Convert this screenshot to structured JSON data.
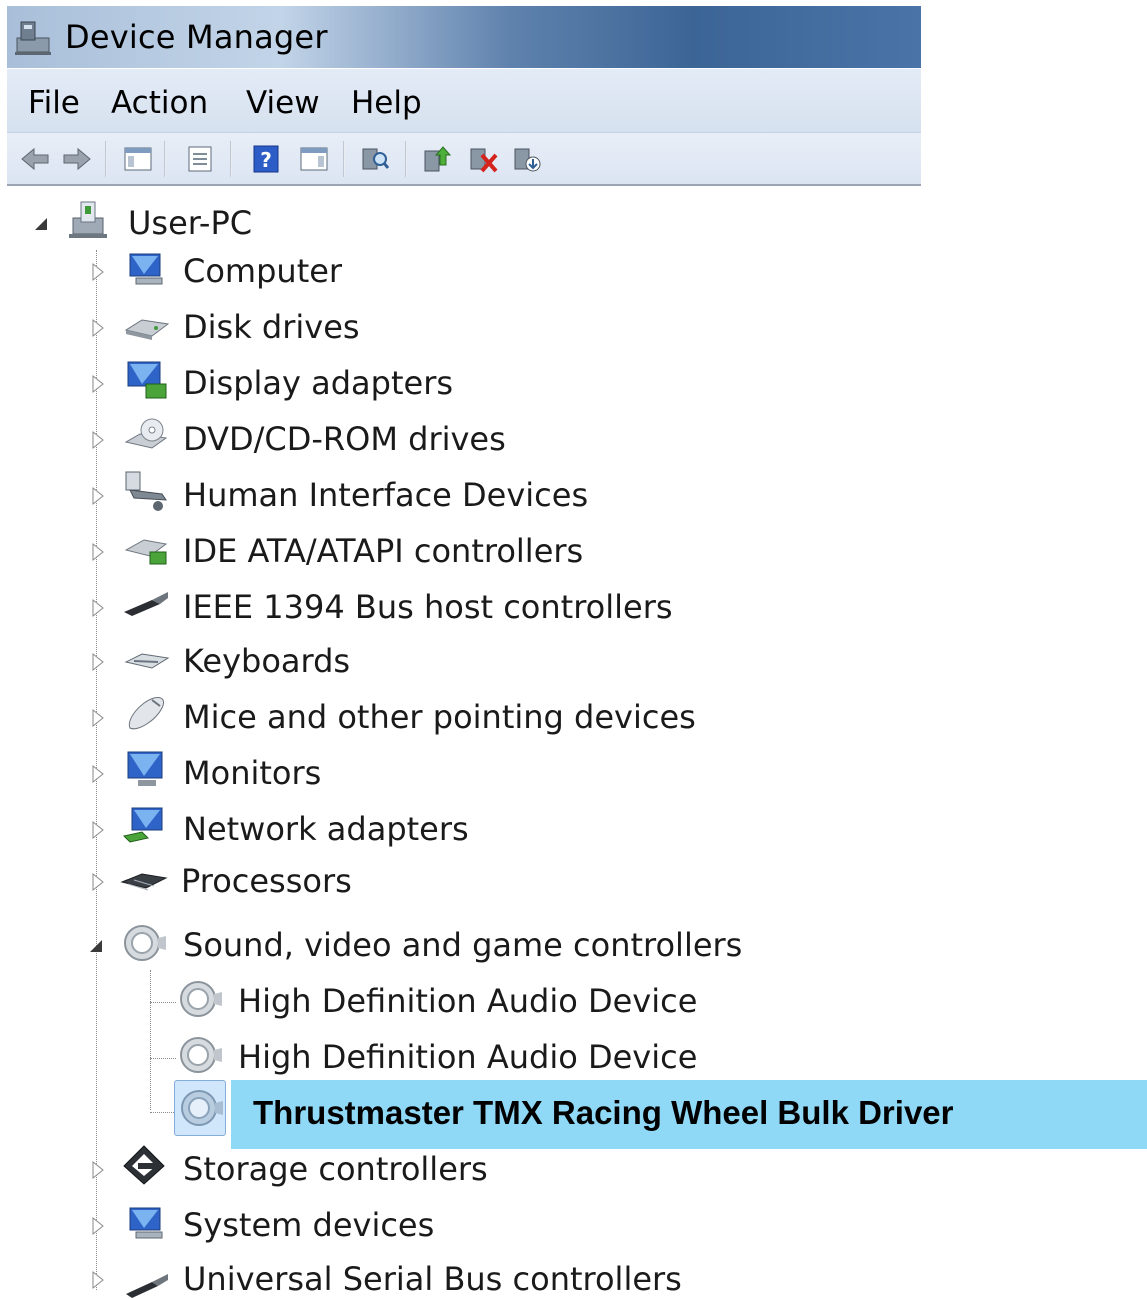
{
  "window": {
    "title": "Device Manager",
    "app_icon": "device-manager-icon"
  },
  "menu": {
    "items": [
      "File",
      "Action",
      "View",
      "Help"
    ]
  },
  "toolbar": {
    "buttons": [
      "back-arrow-icon",
      "forward-arrow-icon",
      "show-hide-console-tree-icon",
      "properties-icon",
      "help-icon",
      "show-action-pane-icon",
      "scan-hardware-changes-icon",
      "update-driver-icon",
      "uninstall-device-icon",
      "add-legacy-hardware-icon"
    ]
  },
  "tree": {
    "root": {
      "label": "User-PC",
      "expanded": true
    },
    "categories": [
      {
        "label": "Computer",
        "icon": "computer-icon"
      },
      {
        "label": "Disk drives",
        "icon": "disk-drive-icon"
      },
      {
        "label": "Display adapters",
        "icon": "display-adapter-icon"
      },
      {
        "label": "DVD/CD-ROM drives",
        "icon": "dvd-drive-icon"
      },
      {
        "label": "Human Interface Devices",
        "icon": "hid-icon"
      },
      {
        "label": "IDE ATA/ATAPI controllers",
        "icon": "ide-controller-icon"
      },
      {
        "label": "IEEE 1394 Bus host controllers",
        "icon": "firewire-icon"
      },
      {
        "label": "Keyboards",
        "icon": "keyboard-icon"
      },
      {
        "label": "Mice and other pointing devices",
        "icon": "mouse-icon"
      },
      {
        "label": "Monitors",
        "icon": "monitor-icon"
      },
      {
        "label": "Network adapters",
        "icon": "network-adapter-icon"
      },
      {
        "label": "Processors",
        "icon": "processor-icon"
      },
      {
        "label": "Sound, video and game controllers",
        "icon": "speaker-icon",
        "expanded": true
      },
      {
        "label": "Storage controllers",
        "icon": "storage-controller-icon"
      },
      {
        "label": "System devices",
        "icon": "system-device-icon"
      },
      {
        "label": "Universal Serial Bus controllers",
        "icon": "usb-icon"
      }
    ],
    "sound_children": [
      {
        "label": "High Definition Audio Device"
      },
      {
        "label": "High Definition Audio Device"
      },
      {
        "label": "Thrustmaster TMX Racing Wheel Bulk Driver",
        "selected": true
      }
    ]
  },
  "colors": {
    "highlight": "#8fd9f7",
    "title_gradient_dark": "#3c6596",
    "menubar": "#dbe5f2"
  }
}
